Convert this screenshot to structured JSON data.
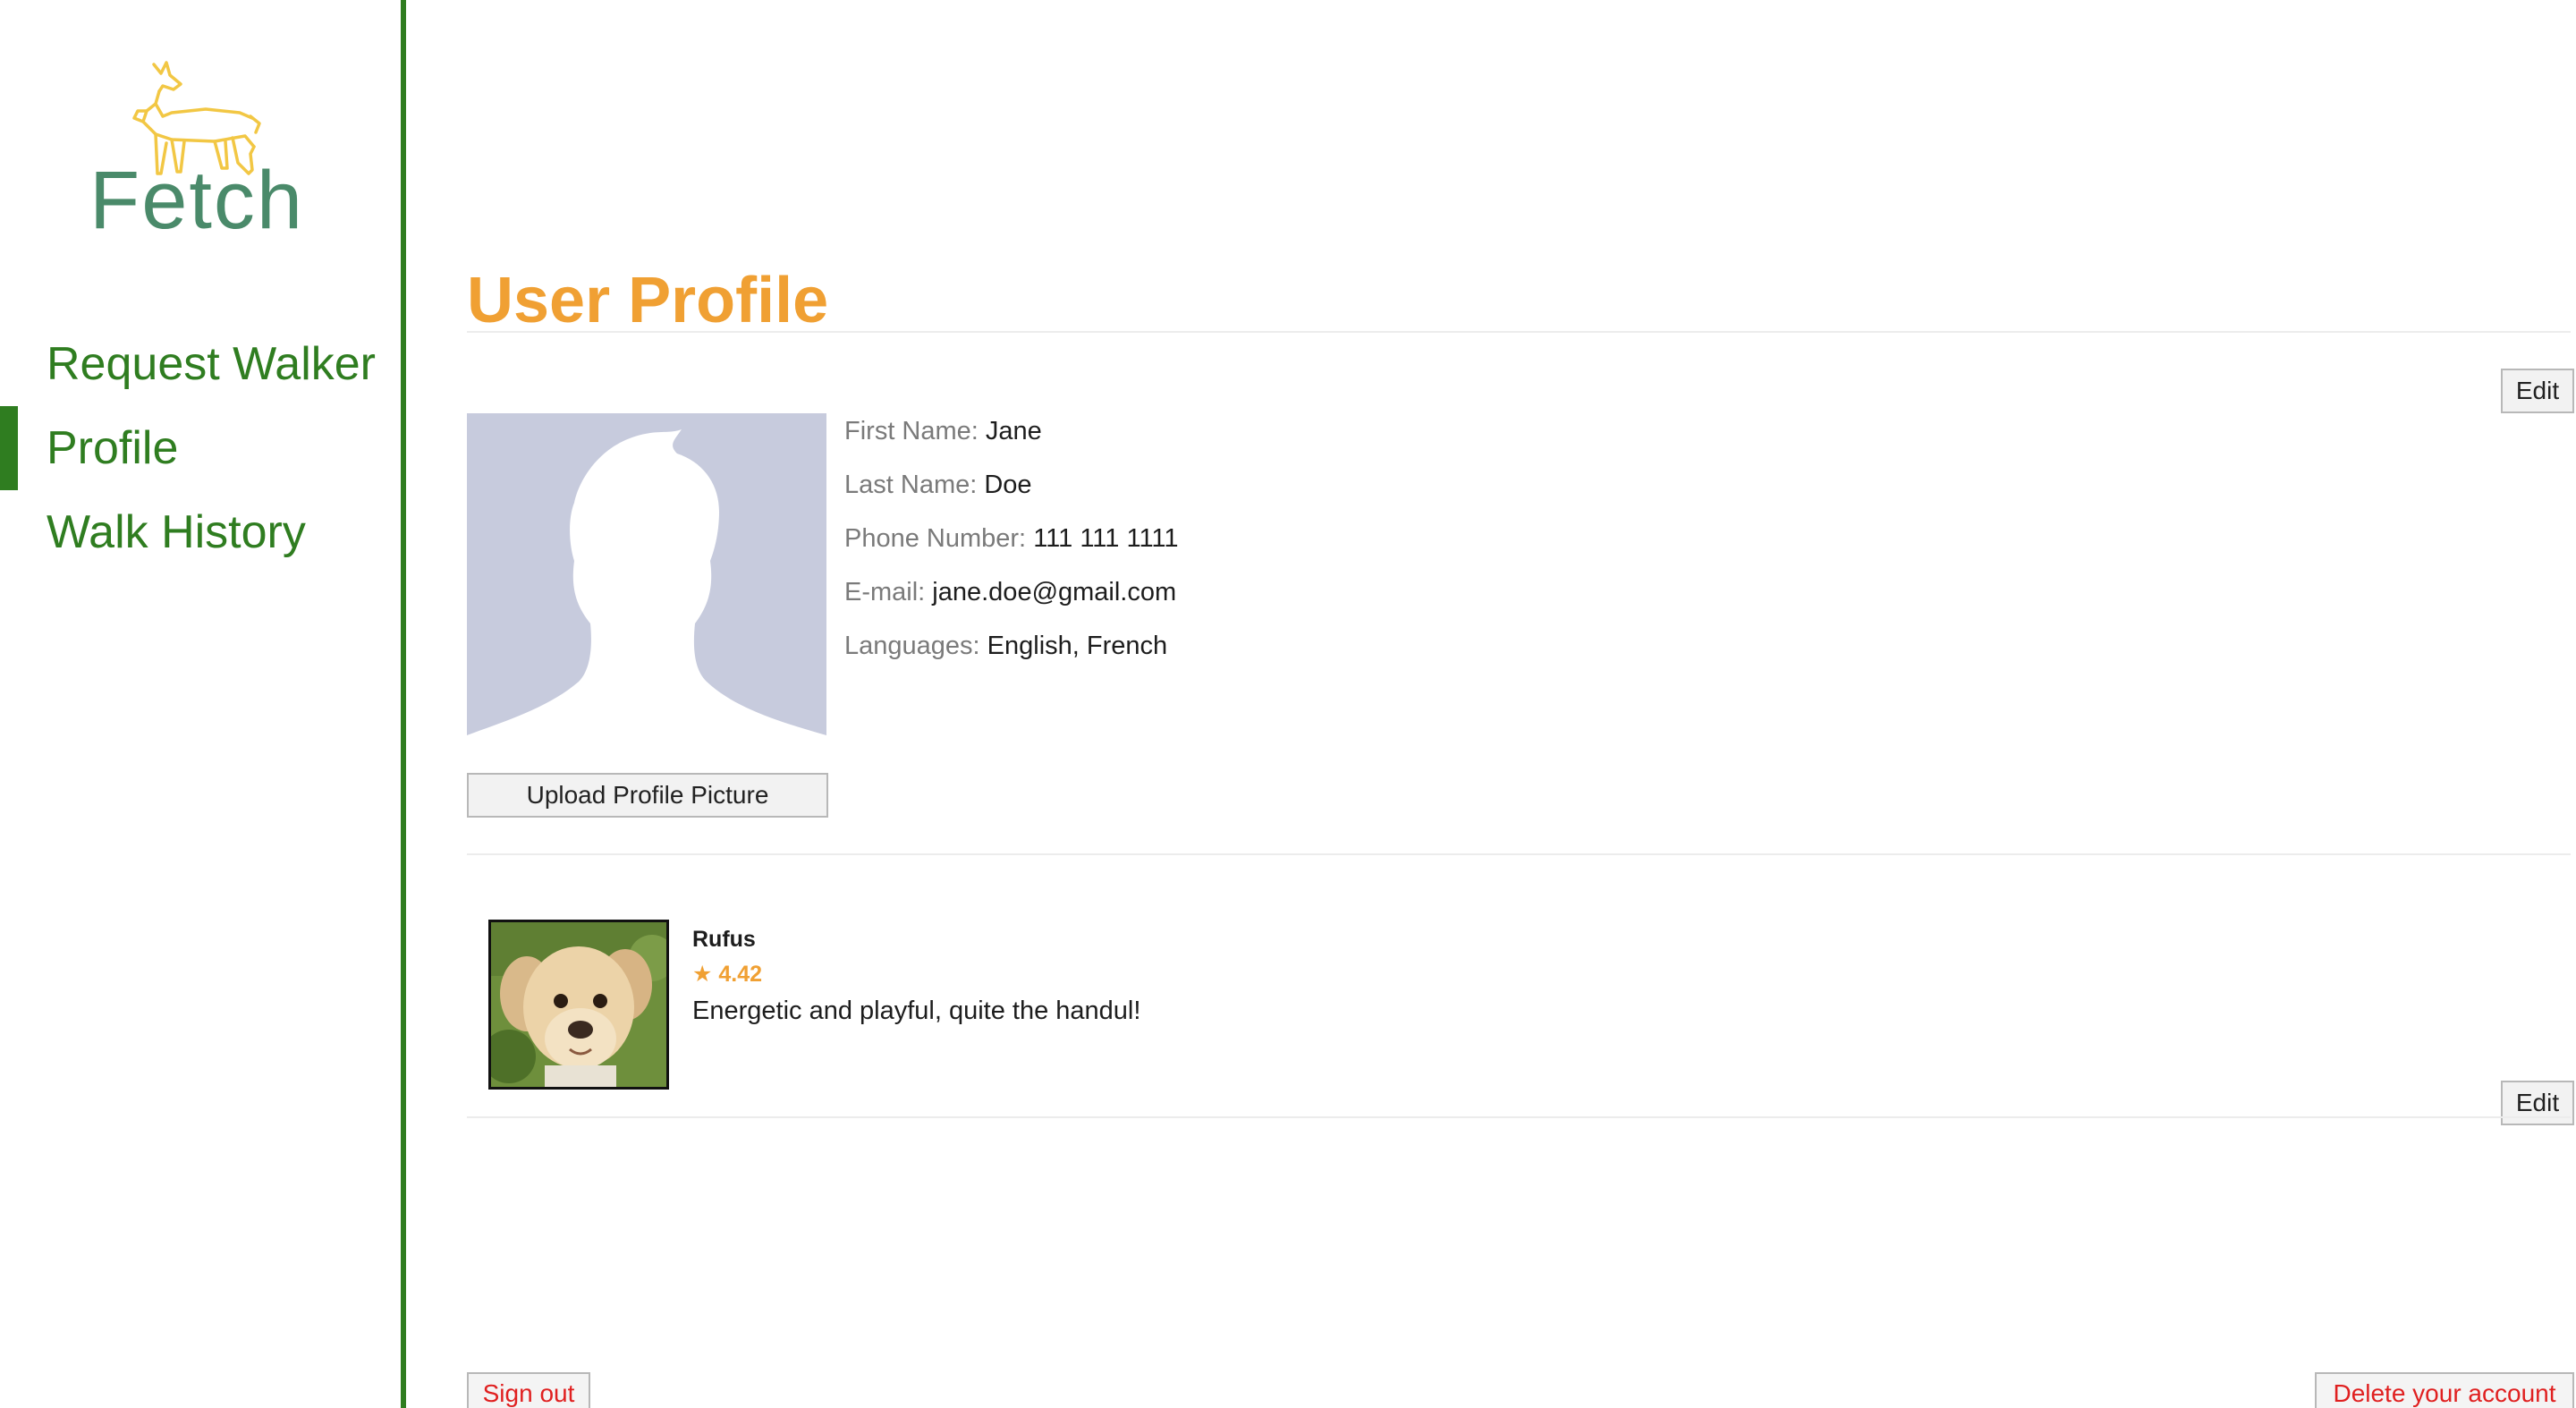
{
  "app": {
    "name": "Fetch"
  },
  "nav": {
    "items": [
      {
        "label": "Request Walker",
        "active": false
      },
      {
        "label": "Profile",
        "active": true
      },
      {
        "label": "Walk History",
        "active": false
      }
    ]
  },
  "profile": {
    "title": "User Profile",
    "edit_label": "Edit",
    "upload_label": "Upload Profile Picture",
    "fields": [
      {
        "label": "First Name:",
        "value": "Jane"
      },
      {
        "label": "Last Name:",
        "value": "Doe"
      },
      {
        "label": "Phone Number:",
        "value": "111 111 1111"
      },
      {
        "label": "E-mail:",
        "value": "jane.doe@gmail.com"
      },
      {
        "label": "Languages:",
        "value": "English, French"
      }
    ]
  },
  "dog": {
    "name": "Rufus",
    "rating_icon": "star-icon",
    "rating": "4.42",
    "description": "Energetic and playful, quite the handul!",
    "edit_label": "Edit"
  },
  "footer": {
    "sign_out_label": "Sign out",
    "delete_label": "Delete your account"
  },
  "colors": {
    "accent_green": "#2f7d20",
    "title_orange": "#f0a033",
    "danger_red": "#e02020",
    "logo_yellow": "#f2c744",
    "logo_text": "#4a8a6a",
    "avatar_bg": "#c7cbdd"
  }
}
